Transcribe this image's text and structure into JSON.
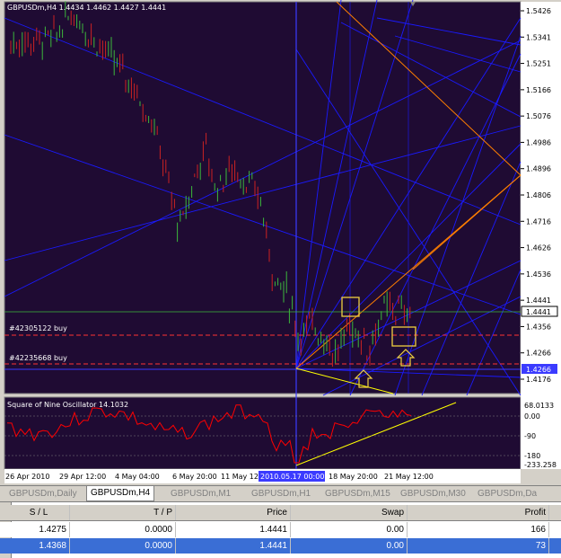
{
  "chart": {
    "title": "GBPUSDm,H4  1.4434 1.4462 1.4427 1.4441",
    "indicator_title": "Square of Nine Oscillator 14.1032",
    "price_labels": [
      "1.5426",
      "1.5341",
      "1.5251",
      "1.5166",
      "1.5076",
      "1.4986",
      "1.4896",
      "1.4806",
      "1.4716",
      "1.4626",
      "1.4536",
      "1.4441",
      "1.4356",
      "1.4266",
      "1.4176"
    ],
    "current_price": "1.4441",
    "order_price_box": "1.4266",
    "osc_labels": [
      "68.0133",
      "0.00",
      "-90",
      "-180",
      "-233.258"
    ],
    "time_labels": [
      "26 Apr 2010",
      "29 Apr 12:00",
      "4 May 04:00",
      "6 May 20:00",
      "11 May 12",
      "2010.05.17 00:00",
      "18 May 20:00",
      "21 May 12:00"
    ],
    "orders": [
      "#42305122 buy",
      "#42235668 buy"
    ],
    "colors": {
      "background": "#1f0b33",
      "grid_line": "#1a1aff",
      "candle_up": "#3cb83c",
      "candle_down": "#cc2222",
      "fan": "#ff7f00",
      "trend": "#ffff00",
      "osc": "#ff0000",
      "order_line": "#ff3333",
      "price_line": "#3cb83c"
    }
  },
  "tabs": [
    "GBPUSDm,Daily",
    "GBPUSDm,H4",
    "GBPUSDm,M1",
    "GBPUSDm,H1",
    "GBPUSDm,M15",
    "GBPUSDm,M30",
    "GBPUSDm,Da"
  ],
  "active_tab": "GBPUSDm,H4",
  "terminal": {
    "headers": {
      "sl": "S / L",
      "tp": "T / P",
      "price": "Price",
      "swap": "Swap",
      "profit": "Profit"
    },
    "rows": [
      {
        "sl": "1.4275",
        "tp": "0.0000",
        "price": "1.4441",
        "swap": "0.00",
        "profit": "166"
      },
      {
        "sl": "1.4368",
        "tp": "0.0000",
        "price": "1.4441",
        "swap": "0.00",
        "profit": "73"
      }
    ]
  },
  "chart_data": {
    "type": "candlestick",
    "title": "GBPUSDm,H4",
    "ylim": [
      1.4176,
      1.5426
    ],
    "last": {
      "open": 1.4434,
      "high": 1.4462,
      "low": 1.4427,
      "close": 1.4441
    }
  }
}
